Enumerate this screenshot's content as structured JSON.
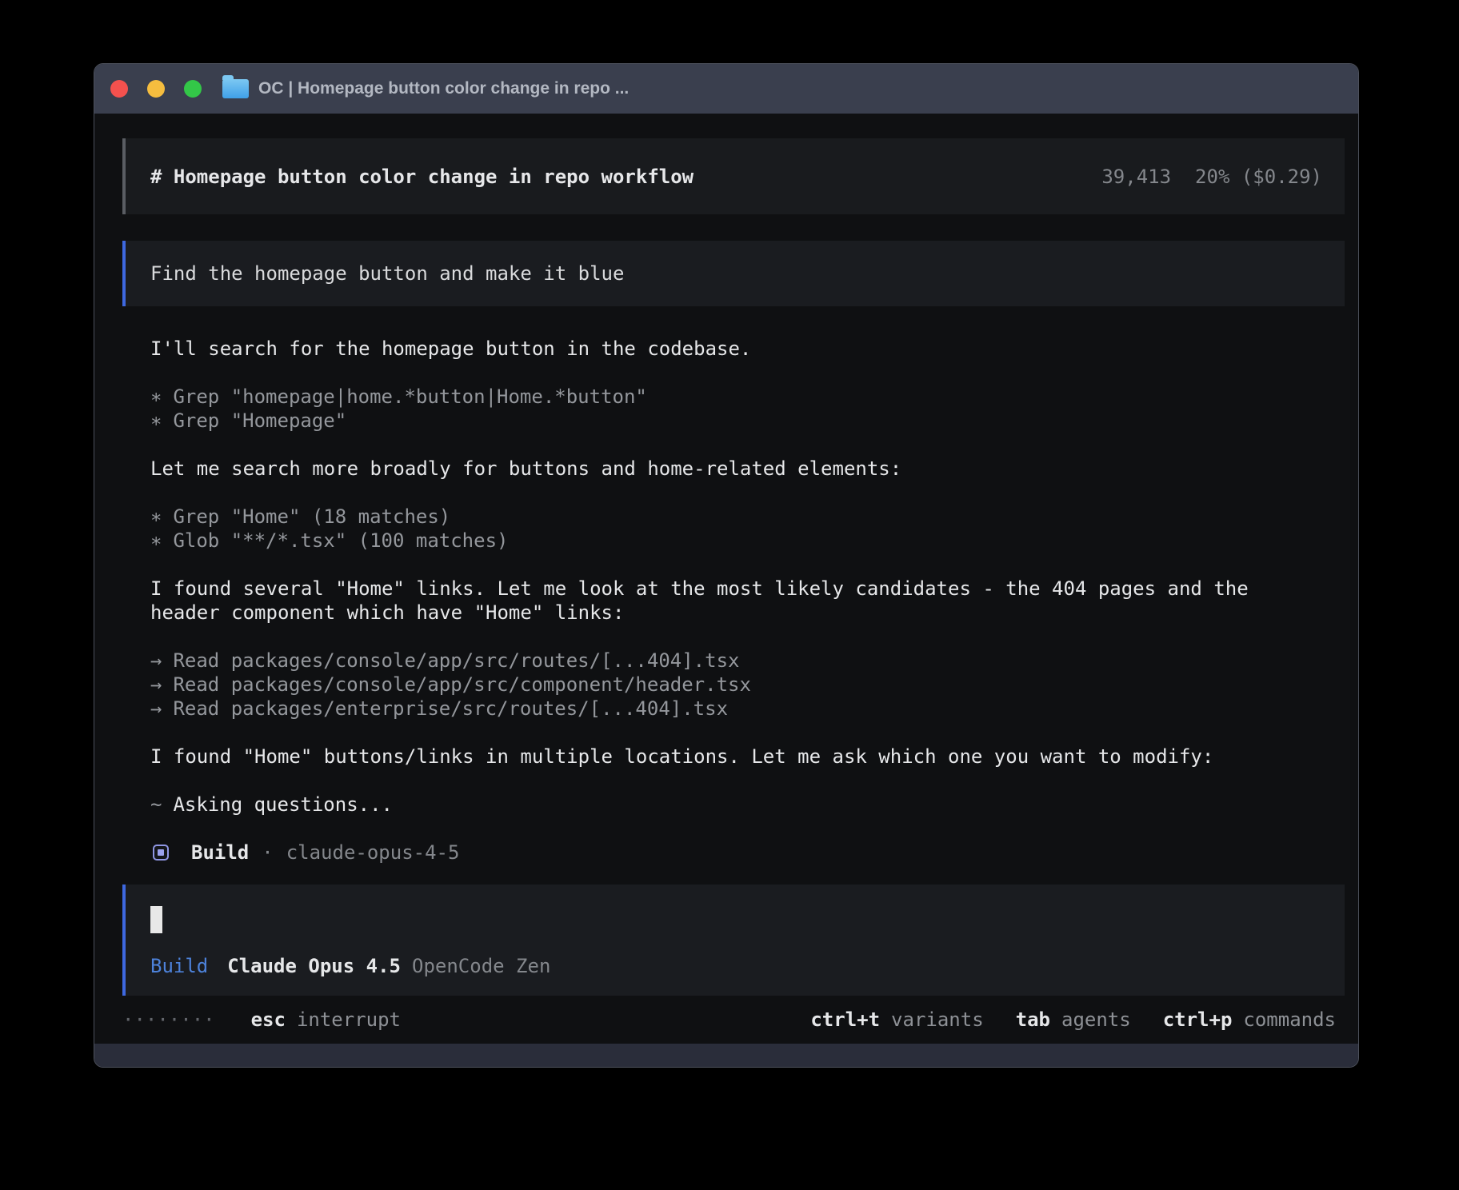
{
  "window": {
    "title": "OC | Homepage button color change in repo ..."
  },
  "header": {
    "title": "# Homepage button color change in repo workflow",
    "tokens": "39,413",
    "usage": "20% ($0.29)"
  },
  "user_message": {
    "text": "Find the homepage button and make it blue"
  },
  "assistant": {
    "p1": "I'll search for the homepage button in the codebase.",
    "tools1": [
      {
        "sym": "∗",
        "text": "Grep \"homepage|home.*button|Home.*button\""
      },
      {
        "sym": "∗",
        "text": "Grep \"Homepage\""
      }
    ],
    "p2": "Let me search more broadly for buttons and home-related elements:",
    "tools2": [
      {
        "sym": "∗",
        "text": "Grep \"Home\" (18 matches)"
      },
      {
        "sym": "∗",
        "text": "Glob \"**/*.tsx\" (100 matches)"
      }
    ],
    "p3": "I found several \"Home\" links. Let me look at the most likely candidates - the 404 pages and the header component which have \"Home\" links:",
    "tools3": [
      {
        "sym": "→",
        "text": "Read packages/console/app/src/routes/[...404].tsx"
      },
      {
        "sym": "→",
        "text": "Read packages/console/app/src/component/header.tsx"
      },
      {
        "sym": "→",
        "text": "Read packages/enterprise/src/routes/[...404].tsx"
      }
    ],
    "p4": "I found \"Home\" buttons/links in multiple locations. Let me ask which one you want to modify:",
    "working": {
      "sym": "~",
      "text": "Asking questions..."
    },
    "agent_line": {
      "agent": "Build",
      "sep": "·",
      "model": "claude-opus-4-5"
    }
  },
  "input": {
    "agent": "Build",
    "model": "Claude Opus 4.5",
    "provider": "OpenCode Zen"
  },
  "status_bar": {
    "spinner": "········",
    "esc_key": "esc",
    "esc_label": "interrupt",
    "shortcuts": [
      {
        "key": "ctrl+t",
        "label": "variants"
      },
      {
        "key": "tab",
        "label": "agents"
      },
      {
        "key": "ctrl+p",
        "label": "commands"
      }
    ]
  },
  "colors": {
    "accent_blue_border": "#3e68e0",
    "agent_blue_text": "#4d82da",
    "badge_lavender": "#8f96e3",
    "traffic_red": "#f4514e",
    "traffic_yellow": "#f5bd3f",
    "traffic_green": "#33c748",
    "titlebar_bg": "#3a3f4e",
    "terminal_bg": "#0f1012"
  }
}
